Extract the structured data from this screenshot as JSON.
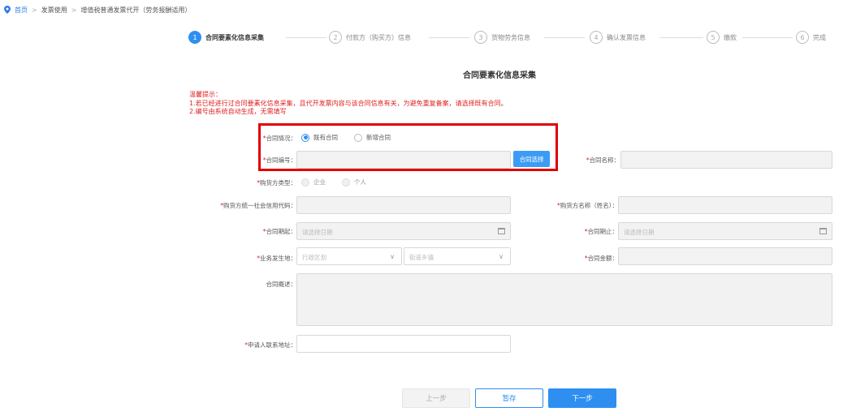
{
  "breadcrumb": {
    "home": "首页",
    "sep": ">",
    "item1": "发票使用",
    "item2": "增值税普通发票代开（劳务报酬适用）"
  },
  "steps": [
    {
      "num": "1",
      "label": "合同要素化信息采集",
      "active": true
    },
    {
      "num": "2",
      "label": "付款方（购买方）信息",
      "active": false
    },
    {
      "num": "3",
      "label": "货物劳务信息",
      "active": false
    },
    {
      "num": "4",
      "label": "确认发票信息",
      "active": false
    },
    {
      "num": "5",
      "label": "缴款",
      "active": false
    },
    {
      "num": "6",
      "label": "完成",
      "active": false
    }
  ],
  "section_title": "合同要素化信息采集",
  "notice": {
    "title": "温馨提示：",
    "line1": "1.若已经进行过合同要素化信息采集，且代开发票内容与该合同信息有关，为避免重复备案，请选择既有合同。",
    "line2": "2.编号由系统自动生成，无需填写"
  },
  "form": {
    "contract_status_label": "合同情况：",
    "contract_status_options": [
      "既有合同",
      "新增合同"
    ],
    "contract_status_selected": "既有合同",
    "contract_no_label": "合同编号：",
    "contract_no_value": "",
    "contract_select_button": "合同选择",
    "contract_name_label": "合同名称：",
    "contract_name_value": "",
    "buyer_type_label": "购货方类型：",
    "buyer_type_options": [
      "企业",
      "个人"
    ],
    "buyer_credit_code_label": "购货方统一社会信用代码：",
    "buyer_name_label": "购货方名称（姓名）：",
    "start_date_label": "合同期起：",
    "start_date_placeholder": "请选择日期",
    "end_date_label": "合同期止：",
    "end_date_placeholder": "请选择日期",
    "location_label": "业务发生地：",
    "district_placeholder": "行政区划",
    "street_placeholder": "街道乡镇",
    "amount_label": "合同金额：",
    "summary_label": "合同概述：",
    "address_label": "申请人联系地址："
  },
  "buttons": {
    "prev": "上一步",
    "save": "暂存",
    "next": "下一步"
  },
  "colors": {
    "accent": "#2e8ff0",
    "highlight": "#e00000",
    "notice": "#e02020"
  }
}
